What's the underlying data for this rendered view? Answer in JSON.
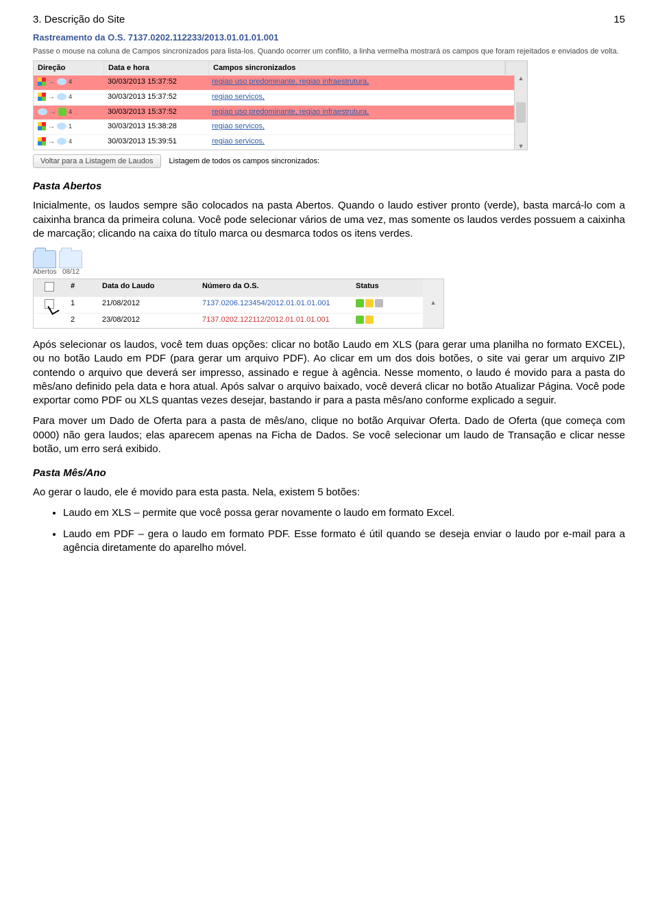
{
  "header": {
    "section_title": "3. Descrição do Site",
    "page_number": "15"
  },
  "ss1": {
    "title": "Rastreamento da O.S. 7137.0202.112233/2013.01.01.01.001",
    "desc": "Passe o mouse na coluna de Campos sincronizados para lista-los. Quando ocorrer um conflito, a linha vermelha mostrará os campos que foram rejeitados e enviados de volta.",
    "columns": {
      "dir": "Direção",
      "date": "Data e hora",
      "campos": "Campos sincronizados"
    },
    "rows": [
      {
        "red": true,
        "dir_count": "4",
        "date": "30/03/2013 15:37:52",
        "campos": "regiao uso predominante, regiao infraestrutura,"
      },
      {
        "red": false,
        "dir_count": "4",
        "date": "30/03/2013 15:37:52",
        "campos": "regiao servicos,"
      },
      {
        "red": true,
        "dir_count": "4",
        "date": "30/03/2013 15:37:52",
        "campos": "regiao uso predominante, regiao infraestrutura,"
      },
      {
        "red": false,
        "dir_count": "1",
        "date": "30/03/2013 15:38:28",
        "campos": "regiao servicos,"
      },
      {
        "red": false,
        "dir_count": "4",
        "date": "30/03/2013 15:39:51",
        "campos": "regiao servicos,"
      }
    ],
    "btn_back": "Voltar para a Listagem de Laudos",
    "bottom_label": "Listagem de todos os campos sincronizados:"
  },
  "sec_abertos": {
    "heading": "Pasta Abertos",
    "p1": "Inicialmente, os laudos sempre são colocados na pasta Abertos. Quando o laudo estiver pronto (verde), basta marcá-lo com a caixinha branca da primeira coluna. Você pode selecionar vários de uma vez, mas somente os laudos verdes possuem a caixinha de marcação; clicando na caixa do título marca ou desmarca todos os itens verdes."
  },
  "ss2": {
    "tabs": {
      "abertos": "Abertos",
      "mes": "08/12"
    },
    "columns": {
      "num": "#",
      "date": "Data do Laudo",
      "os": "Número da O.S.",
      "status": "Status"
    },
    "rows": [
      {
        "num": "1",
        "date": "21/08/2012",
        "os": "7137.0206.123454/2012.01.01.01.001",
        "red": false
      },
      {
        "num": "2",
        "date": "23/08/2012",
        "os": "7137.0202.122112/2012.01.01.01.001",
        "red": true
      }
    ]
  },
  "p_after_ss2": "Após selecionar os laudos, você tem duas opções: clicar no botão Laudo em XLS (para gerar uma planilha no formato EXCEL), ou no botão Laudo em PDF (para gerar um arquivo PDF). Ao clicar em um dos dois botões, o site vai gerar um arquivo ZIP contendo o arquivo que deverá ser impresso, assinado e regue à agência. Nesse momento, o laudo é movido para a pasta do mês/ano definido pela data e hora atual. Após salvar o arquivo baixado, você deverá clicar no botão Atualizar Página. Você pode exportar como PDF ou XLS quantas vezes desejar, bastando ir para a pasta mês/ano conforme explicado a seguir.",
  "p_mover": "Para mover um Dado de Oferta para a pasta de mês/ano, clique no botão Arquivar Oferta. Dado de Oferta (que começa com 0000) não gera laudos; elas aparecem apenas na Ficha de Dados. Se você selecionar um laudo de Transação e clicar nesse botão, um erro será exibido.",
  "sec_mesano": {
    "heading": "Pasta Mês/Ano",
    "intro": "Ao gerar o laudo, ele é movido para esta pasta. Nela, existem 5 botões:",
    "bullets": [
      "Laudo em XLS – permite que você possa gerar novamente o laudo em formato Excel.",
      "Laudo em PDF – gera o laudo em formato PDF. Esse formato é útil quando se deseja enviar o laudo por e-mail para a agência diretamente do aparelho móvel."
    ]
  }
}
